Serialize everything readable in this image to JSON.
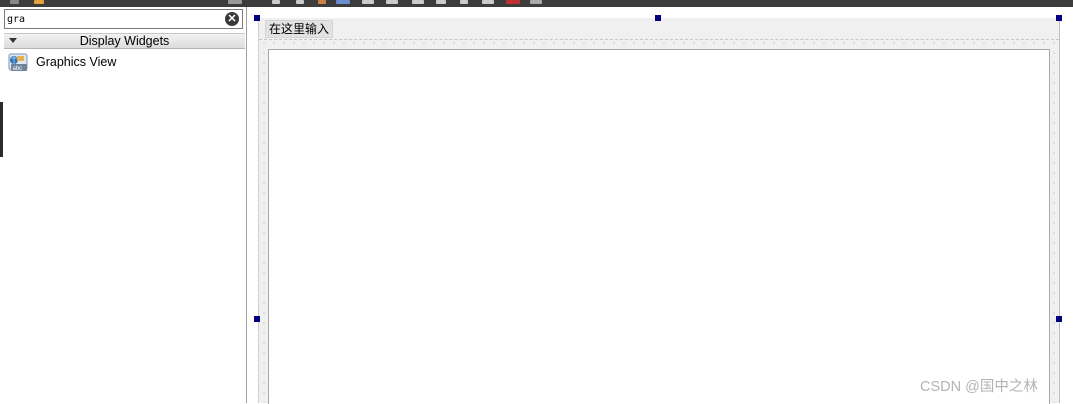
{
  "toolbar": {
    "icons": [
      "widget-box-icon",
      "edit-icon",
      "layout-horizontal-icon",
      "layout-vertical-icon",
      "grid-layout-icon",
      "break-layout-icon",
      "adjust-size-icon"
    ]
  },
  "widget_box": {
    "filter": {
      "value": "gra",
      "clear_icon": "clear-icon"
    },
    "category": {
      "label": "Display Widgets",
      "icon": "collapse-arrow-icon"
    },
    "items": [
      {
        "label": "Graphics View",
        "icon": "graphics-view-icon"
      }
    ]
  },
  "form": {
    "menubar": {
      "placeholder_item": "在这里输入"
    },
    "central_widget": "graphics-view"
  },
  "watermark": "CSDN @国中之林",
  "colors": {
    "selection_handle": "#000080",
    "form_background": "#f0f0f0",
    "toolbar_background": "#3c3c3c"
  }
}
